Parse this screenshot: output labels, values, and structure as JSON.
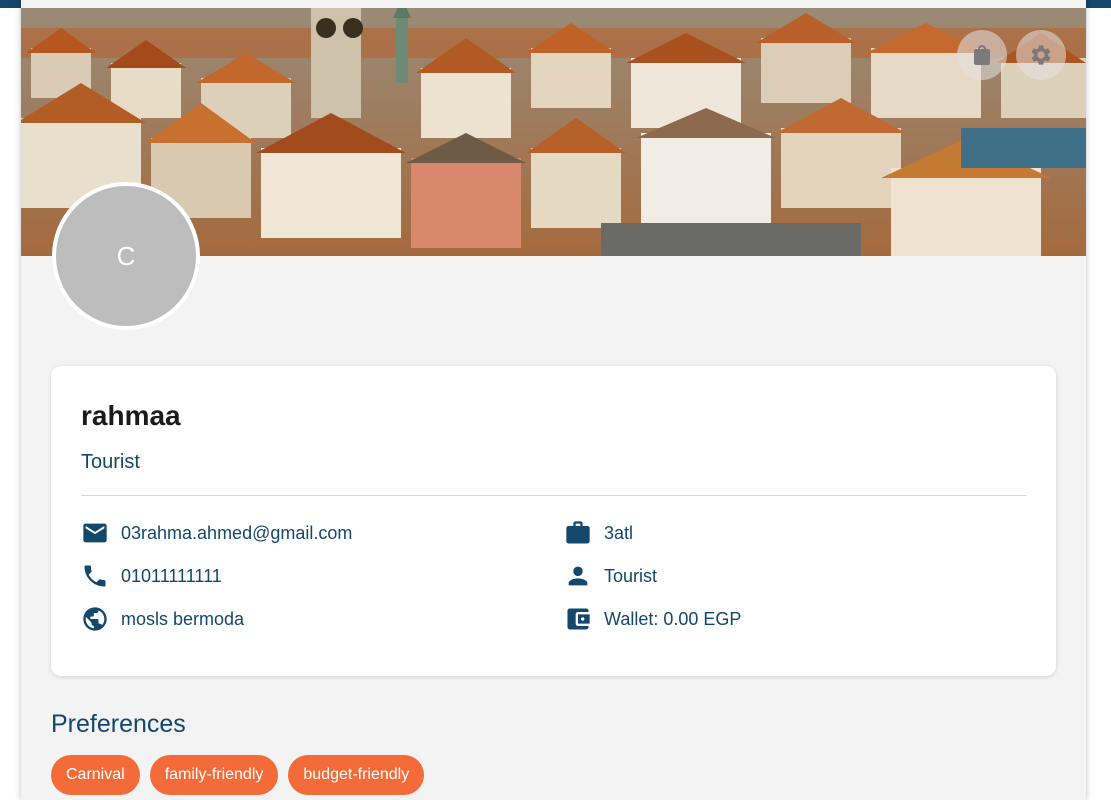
{
  "profile": {
    "avatar_initial": "C",
    "name": "rahmaa",
    "role": "Tourist"
  },
  "header_actions": {
    "bag_icon": "shopping-bag-icon",
    "settings_icon": "gear-icon"
  },
  "details": {
    "email": "03rahma.ahmed@gmail.com",
    "phone": "01011111111",
    "nationality": "mosls bermoda",
    "job": "3atl",
    "user_type": "Tourist",
    "wallet": "Wallet: 0.00 EGP"
  },
  "preferences": {
    "title": "Preferences",
    "tags": [
      "Carnival",
      "family-friendly",
      "budget-friendly"
    ]
  },
  "colors": {
    "accent": "#13476b",
    "chip": "#f26b38",
    "avatar": "#bdbdbd"
  }
}
